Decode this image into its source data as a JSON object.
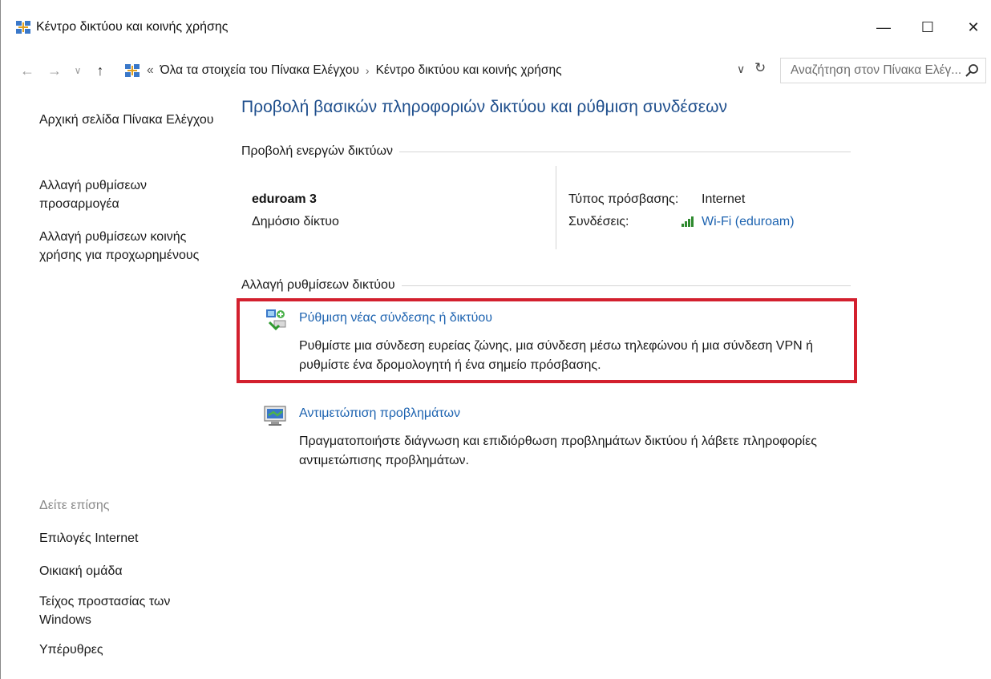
{
  "window": {
    "title": "Κέντρο δικτύου και κοινής χρήσης",
    "minimize_glyph": "—",
    "maximize_glyph": "☐",
    "close_glyph": "✕"
  },
  "nav": {
    "back_glyph": "←",
    "forward_glyph": "→",
    "recent_glyph": "∨",
    "up_glyph": "↑",
    "breadcrumb_overflow": "«",
    "breadcrumbs": [
      "Όλα τα στοιχεία του Πίνακα Ελέγχου",
      "Κέντρο δικτύου και κοινής χρήσης"
    ],
    "separator": "›",
    "dropdown_glyph": "∨",
    "refresh_glyph": "↻",
    "search_placeholder": "Αναζήτηση στον Πίνακα Ελέγ..."
  },
  "sidebar": {
    "links": [
      "Αρχική σελίδα Πίνακα Ελέγχου",
      "Αλλαγή ρυθμίσεων προσαρμογέα",
      "Αλλαγή ρυθμίσεων κοινής χρήσης για προχωρημένους"
    ],
    "see_also_label": "Δείτε επίσης",
    "see_also": [
      "Επιλογές Internet",
      "Οικιακή ομάδα",
      "Τείχος προστασίας των Windows",
      "Υπέρυθρες"
    ]
  },
  "main": {
    "title": "Προβολή βασικών πληροφοριών δικτύου και ρύθμιση συνδέσεων",
    "active_networks_label": "Προβολή ενεργών δικτύων",
    "network": {
      "name": "eduroam  3",
      "category": "Δημόσιο δίκτυο",
      "access_type_label": "Τύπος πρόσβασης:",
      "access_type_value": "Internet",
      "connections_label": "Συνδέσεις:",
      "connections_value": "Wi-Fi (eduroam)"
    },
    "change_settings_label": "Αλλαγή ρυθμίσεων δικτύου",
    "tasks": [
      {
        "title": "Ρύθμιση νέας σύνδεσης ή δικτύου",
        "description": "Ρυθμίστε μια σύνδεση ευρείας ζώνης, μια σύνδεση μέσω τηλεφώνου ή μια σύνδεση VPN ή ρυθμίστε ένα δρομολογητή ή ένα σημείο πρόσβασης.",
        "icon": "new-connection-icon"
      },
      {
        "title": "Αντιμετώπιση προβλημάτων",
        "description": "Πραγματοποιήστε διάγνωση και επιδιόρθωση προβλημάτων δικτύου ή λάβετε πληροφορίες αντιμετώπισης προβλημάτων.",
        "icon": "troubleshoot-icon"
      }
    ]
  },
  "colors": {
    "title_blue": "#1e4e8c",
    "link_blue": "#1d63b0",
    "highlight_red": "#d3202e",
    "signal_green": "#2f8a2f"
  }
}
